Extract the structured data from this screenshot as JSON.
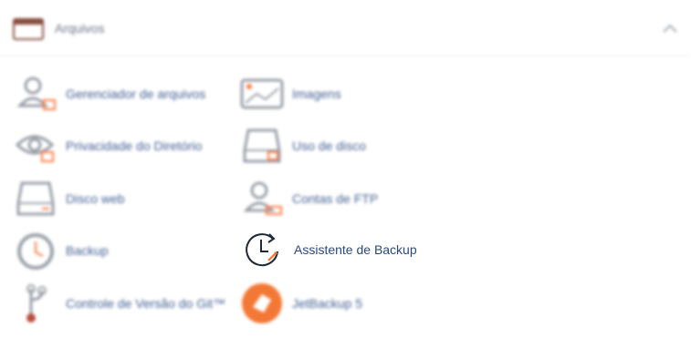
{
  "section": {
    "title": "Arquivos",
    "collapse_icon": "chevron-up-icon"
  },
  "items": [
    {
      "label": "Gerenciador de arquivos",
      "icon": "file-manager-icon"
    },
    {
      "label": "Imagens",
      "icon": "images-icon"
    },
    {
      "label": "Privacidade do Diretório",
      "icon": "eye-icon"
    },
    {
      "label": "Uso de disco",
      "icon": "disk-usage-icon"
    },
    {
      "label": "Disco web",
      "icon": "web-disk-icon"
    },
    {
      "label": "Contas de FTP",
      "icon": "ftp-accounts-icon"
    },
    {
      "label": "Backup",
      "icon": "backup-icon"
    },
    {
      "label": "Assistente de Backup",
      "icon": "backup-wizard-icon"
    },
    {
      "label": "Controle de Versão do Git™",
      "icon": "git-icon"
    },
    {
      "label": "JetBackup 5",
      "icon": "jetbackup-icon"
    }
  ],
  "colors": {
    "label": "#2f4e86",
    "icon_gray": "#8e959f",
    "accent_orange": "#ff6c2c",
    "jetbackup_orange": "#f26a21"
  }
}
